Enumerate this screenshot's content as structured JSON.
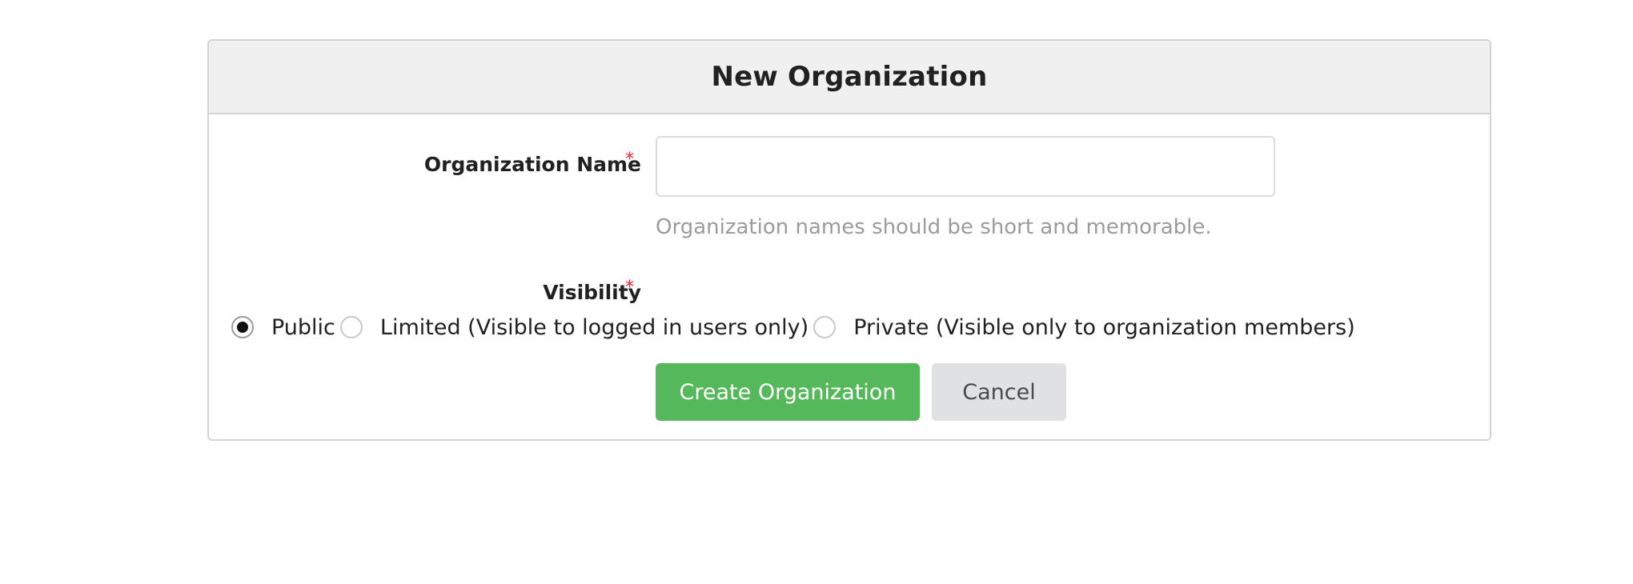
{
  "form": {
    "title": "New Organization",
    "org_name": {
      "label": "Organization Name",
      "required_mark": "*",
      "value": "",
      "placeholder": "",
      "help": "Organization names should be short and memorable."
    },
    "visibility": {
      "label": "Visibility",
      "required_mark": "*",
      "selected": "Public",
      "options": [
        {
          "label": "Public",
          "checked": true
        },
        {
          "label": "Limited (Visible to logged in users only)",
          "checked": false
        },
        {
          "label": "Private (Visible only to organization members)",
          "checked": false
        }
      ]
    },
    "buttons": {
      "create": "Create Organization",
      "cancel": "Cancel"
    }
  },
  "colors": {
    "primary_button": "#55b85a",
    "secondary_button": "#e0e1e2",
    "required": "#db2828",
    "header_bg": "#f0f0f0",
    "help_text": "#9b9b9b"
  }
}
